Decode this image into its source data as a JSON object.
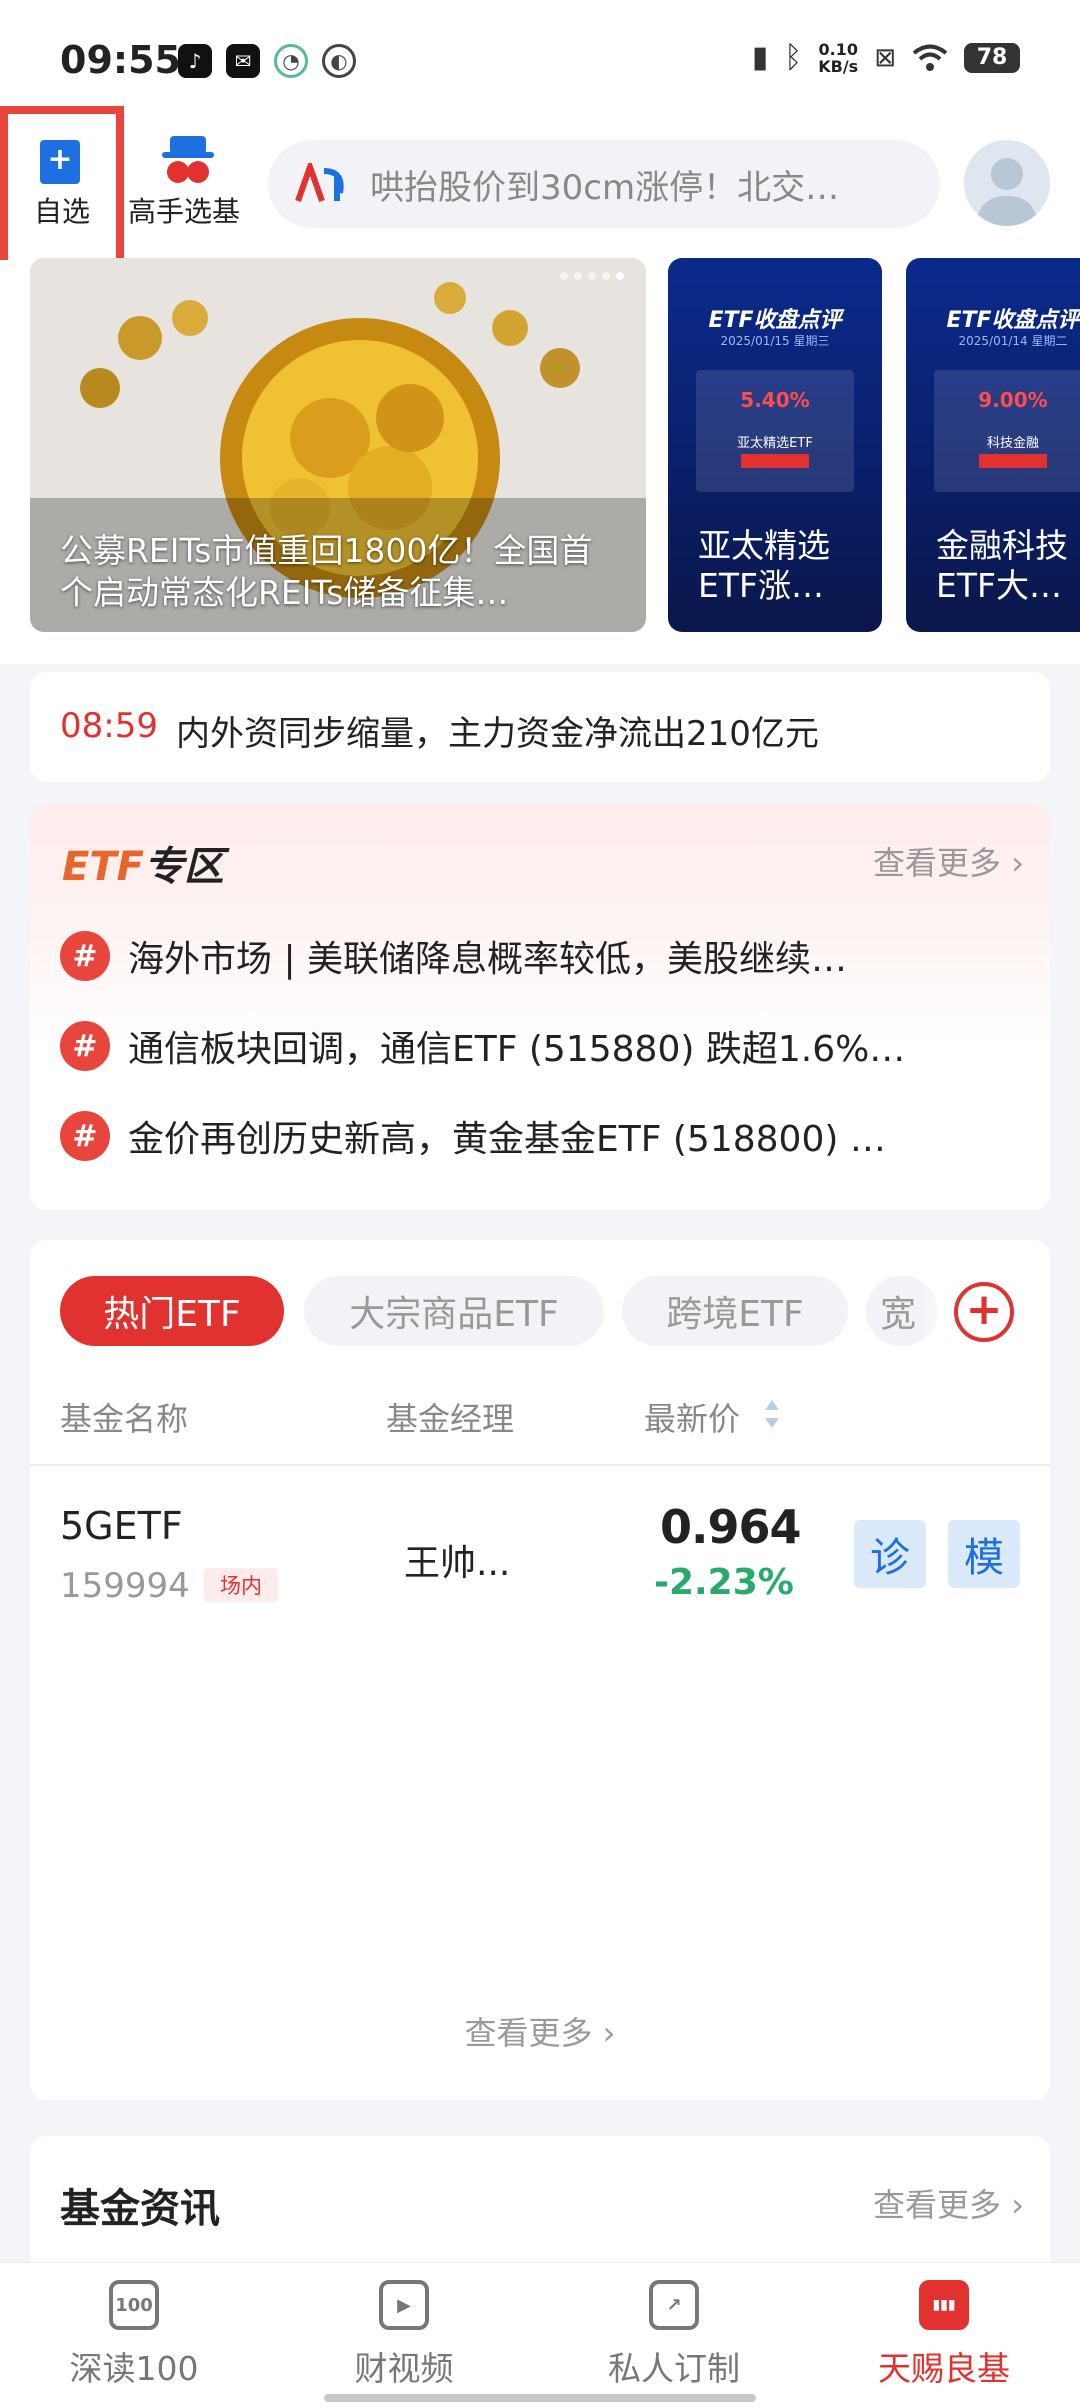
{
  "status_bar": {
    "time": "09:55",
    "net_speed_value": "0.10",
    "net_speed_unit": "KB/s",
    "battery": "78",
    "icons_left": [
      "tiktok-icon",
      "mail-icon",
      "qq-icon",
      "app-icon"
    ],
    "icons_right": [
      "vibrate-icon",
      "bluetooth-icon",
      "sim-off-icon",
      "wifi-icon",
      "battery-icon"
    ]
  },
  "header": {
    "favorites_label": "自选",
    "favorites_icon": "+",
    "expert_label": "高手选基",
    "search_placeholder": "哄抬股价到30cm涨停！北交…",
    "search_logo_text": "AI"
  },
  "banners": {
    "main_caption": "公募REITs市值重回1800亿！全国首个启动常态化REITs储备征集…",
    "cards": [
      {
        "head": "ETF收盘点评",
        "date": "2025/01/15 星期三",
        "pct": "5.40%",
        "name": "亚太精选ETF",
        "caption": "亚太精选ETF涨…"
      },
      {
        "head": "ETF收盘点评",
        "date": "2025/01/14 星期二",
        "pct": "9.00%",
        "name": "科技金融",
        "caption": "金融科技ETF大…"
      }
    ]
  },
  "ticker": {
    "time": "08:59",
    "text": "内外资同步缩量，主力资金净流出210亿元"
  },
  "etf_zone": {
    "logo_prefix": "ETF",
    "logo_suffix": "专区",
    "more": "查看更多 ›",
    "items": [
      "海外市场 | 美联储降息概率较低，美股继续…",
      "通信板块回调，通信ETF (515880) 跌超1.6%…",
      "金价再创历史新高，黄金基金ETF (518800) …"
    ],
    "hash_symbol": "#"
  },
  "etf_list": {
    "tabs": [
      "热门ETF",
      "大宗商品ETF",
      "跨境ETF",
      "宽"
    ],
    "columns": [
      "基金名称",
      "基金经理",
      "最新价"
    ],
    "rows": [
      {
        "name": "5GETF",
        "code": "159994",
        "tag": "场内",
        "manager": "王帅...",
        "price": "0.964",
        "change": "-2.23%",
        "actions": [
          "诊",
          "模"
        ]
      }
    ],
    "more": "查看更多 ›"
  },
  "news": {
    "title": "基金资讯",
    "more": "查看更多 ›"
  },
  "bottom_nav": [
    {
      "label": "深读100",
      "icon": "book-icon",
      "glyph": "100"
    },
    {
      "label": "财视频",
      "icon": "play-icon",
      "glyph": "▶"
    },
    {
      "label": "私人订制",
      "icon": "trend-icon",
      "glyph": "↗"
    },
    {
      "label": "天赐良基",
      "icon": "chart-bar-icon",
      "glyph": "▮▮▮"
    }
  ],
  "colors": {
    "accent_red": "#e2322f",
    "positive_down_green": "#2aaa6a",
    "blue": "#1e6fe0",
    "highlight_box": "#e8453c"
  }
}
